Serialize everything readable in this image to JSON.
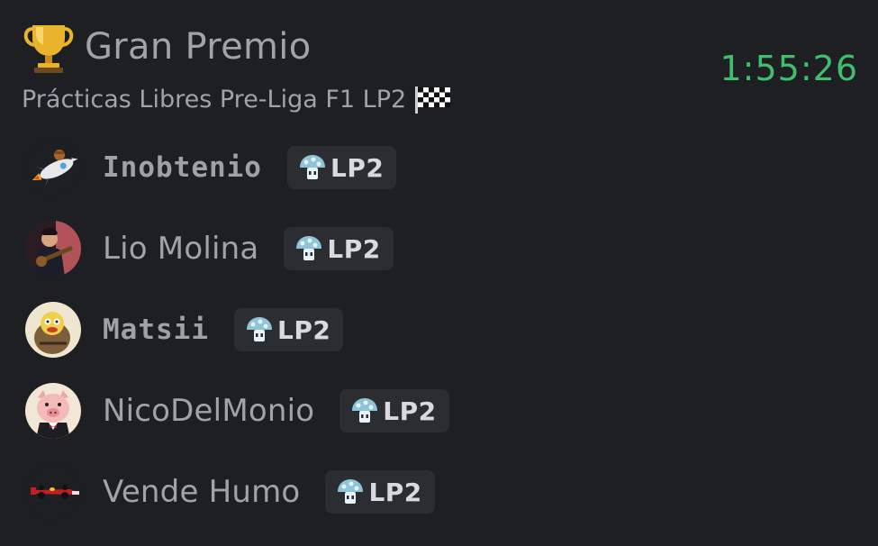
{
  "header": {
    "title": "Gran Premio",
    "subtitle": "Prácticas Libres Pre-Liga F1 LP2",
    "trophy_icon": "trophy-icon",
    "flag_icon": "checkered-flag-icon",
    "timer": "1:55:26",
    "timer_color": "#3fbf6e"
  },
  "members": [
    {
      "name": "Inobtenio",
      "tag": "LP2",
      "avatar_icon": "rocket-avatar"
    },
    {
      "name": "Lio Molina",
      "tag": "LP2",
      "avatar_icon": "guitarist-avatar"
    },
    {
      "name": "Matsii",
      "tag": "LP2",
      "avatar_icon": "cartoon-avatar"
    },
    {
      "name": "NicoDelMonio",
      "tag": "LP2",
      "avatar_icon": "pig-avatar"
    },
    {
      "name": "Vende Humo",
      "tag": "LP2",
      "avatar_icon": "f1-car-avatar"
    }
  ],
  "tag_icon": "mushroom-icon",
  "colors": {
    "background": "#1e1f22",
    "tag_background": "#2b2d31",
    "text": "#a0a3aa"
  }
}
